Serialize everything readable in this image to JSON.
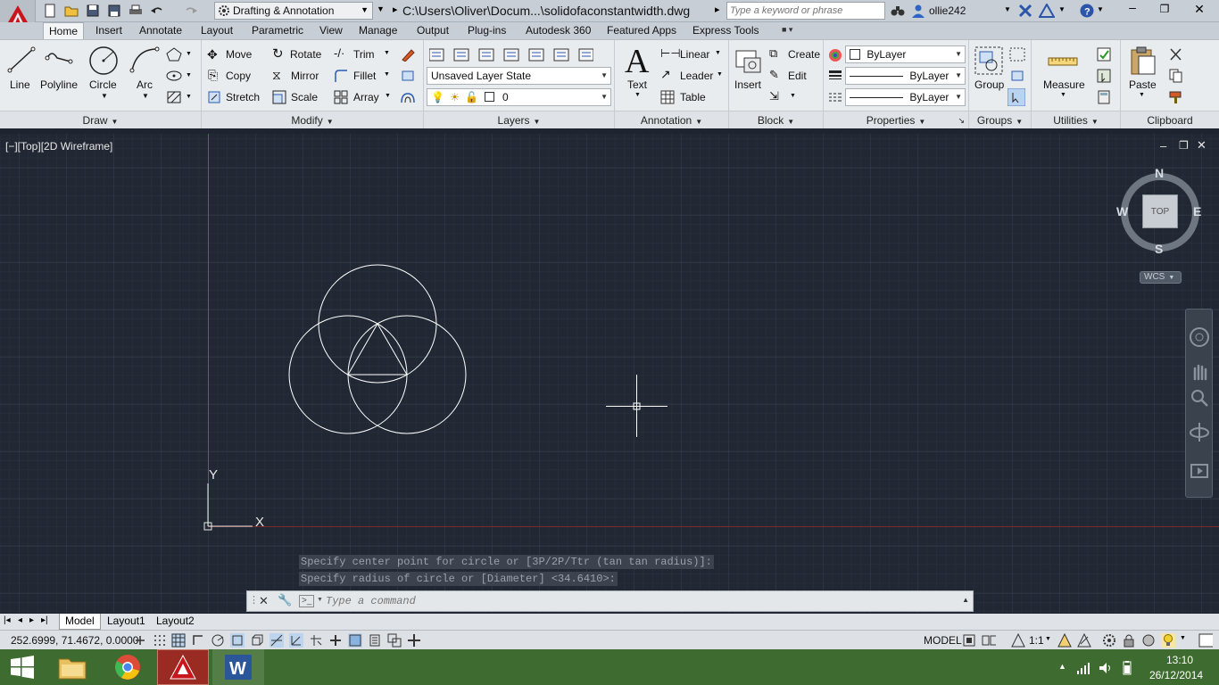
{
  "title_bar": {
    "workspace": "Drafting & Annotation",
    "file_path": "C:\\Users\\Oliver\\Docum...\\solidofaconstantwidth.dwg",
    "search_placeholder": "Type a keyword or phrase",
    "user": "ollie242"
  },
  "tabs": [
    "Home",
    "Insert",
    "Annotate",
    "Layout",
    "Parametric",
    "View",
    "Manage",
    "Output",
    "Plug-ins",
    "Autodesk 360",
    "Featured Apps",
    "Express Tools"
  ],
  "ribbon": {
    "draw": {
      "title": "Draw",
      "tools": [
        "Line",
        "Polyline",
        "Circle",
        "Arc"
      ]
    },
    "modify": {
      "title": "Modify",
      "tools": [
        "Move",
        "Rotate",
        "Trim",
        "Copy",
        "Mirror",
        "Fillet",
        "Stretch",
        "Scale",
        "Array"
      ]
    },
    "layers": {
      "title": "Layers",
      "layer_state": "Unsaved Layer State",
      "current_layer": "0"
    },
    "annotation": {
      "title": "Annotation",
      "text": "Text",
      "linear": "Linear",
      "leader": "Leader",
      "table": "Table"
    },
    "block": {
      "title": "Block",
      "insert": "Insert",
      "create": "Create",
      "edit": "Edit"
    },
    "properties": {
      "title": "Properties",
      "color": "ByLayer",
      "linetype": "ByLayer",
      "lineweight": "ByLayer"
    },
    "groups": {
      "title": "Groups",
      "group": "Group"
    },
    "utilities": {
      "title": "Utilities",
      "measure": "Measure"
    },
    "clipboard": {
      "title": "Clipboard",
      "paste": "Paste"
    }
  },
  "viewport": {
    "label": "[−][Top][2D Wireframe]",
    "viewcube": {
      "north": "N",
      "south": "S",
      "east": "E",
      "west": "W",
      "face": "TOP",
      "wcs": "WCS"
    },
    "ucs": {
      "x": "X",
      "y": "Y"
    }
  },
  "command": {
    "history": [
      "Specify center point for circle or [3P/2P/Ttr (tan tan radius)]:",
      "Specify radius of circle or [Diameter] <34.6410>:"
    ],
    "placeholder": "Type a command"
  },
  "layout_tabs": [
    "Model",
    "Layout1",
    "Layout2"
  ],
  "status": {
    "coords": "252.6999, 71.4672, 0.0000",
    "space": "MODEL",
    "scale": "1:1"
  },
  "taskbar": {
    "time": "13:10",
    "date": "26/12/2014"
  }
}
